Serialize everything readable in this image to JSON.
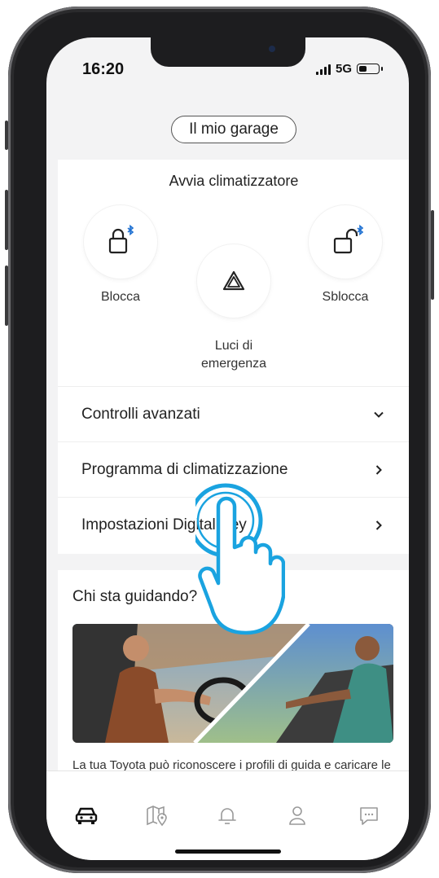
{
  "status_bar": {
    "time": "16:20",
    "network": "5G"
  },
  "header": {
    "garage_button": "Il mio garage"
  },
  "remote_controls": {
    "title": "Avvia climatizzatore",
    "actions": [
      {
        "label": "Blocca",
        "icon": "lock-closed-bluetooth-icon"
      },
      {
        "label": "Luci di emergenza",
        "icon": "hazard-triangle-icon"
      },
      {
        "label": "Sblocca",
        "icon": "lock-open-bluetooth-icon"
      }
    ]
  },
  "menu_rows": [
    {
      "label": "Controlli avanzati",
      "icon": "chevron-down-icon"
    },
    {
      "label": "Programma di climatizzazione",
      "icon": "chevron-right-icon"
    },
    {
      "label": "Impostazioni Digital Key",
      "icon": "chevron-right-icon"
    }
  ],
  "driver_card": {
    "title": "Chi sta guidando?",
    "description": "La tua Toyota può riconoscere i profili di guida e caricare le preferenze non appena entri nel"
  },
  "tab_bar": [
    {
      "icon": "car-icon",
      "active": true
    },
    {
      "icon": "map-pin-icon",
      "active": false
    },
    {
      "icon": "bell-icon",
      "active": false
    },
    {
      "icon": "profile-icon",
      "active": false
    },
    {
      "icon": "chat-icon",
      "active": false
    }
  ],
  "colors": {
    "accent_blue": "#1aa3e0",
    "bluetooth_blue": "#1c6fd1",
    "text": "#222222"
  }
}
